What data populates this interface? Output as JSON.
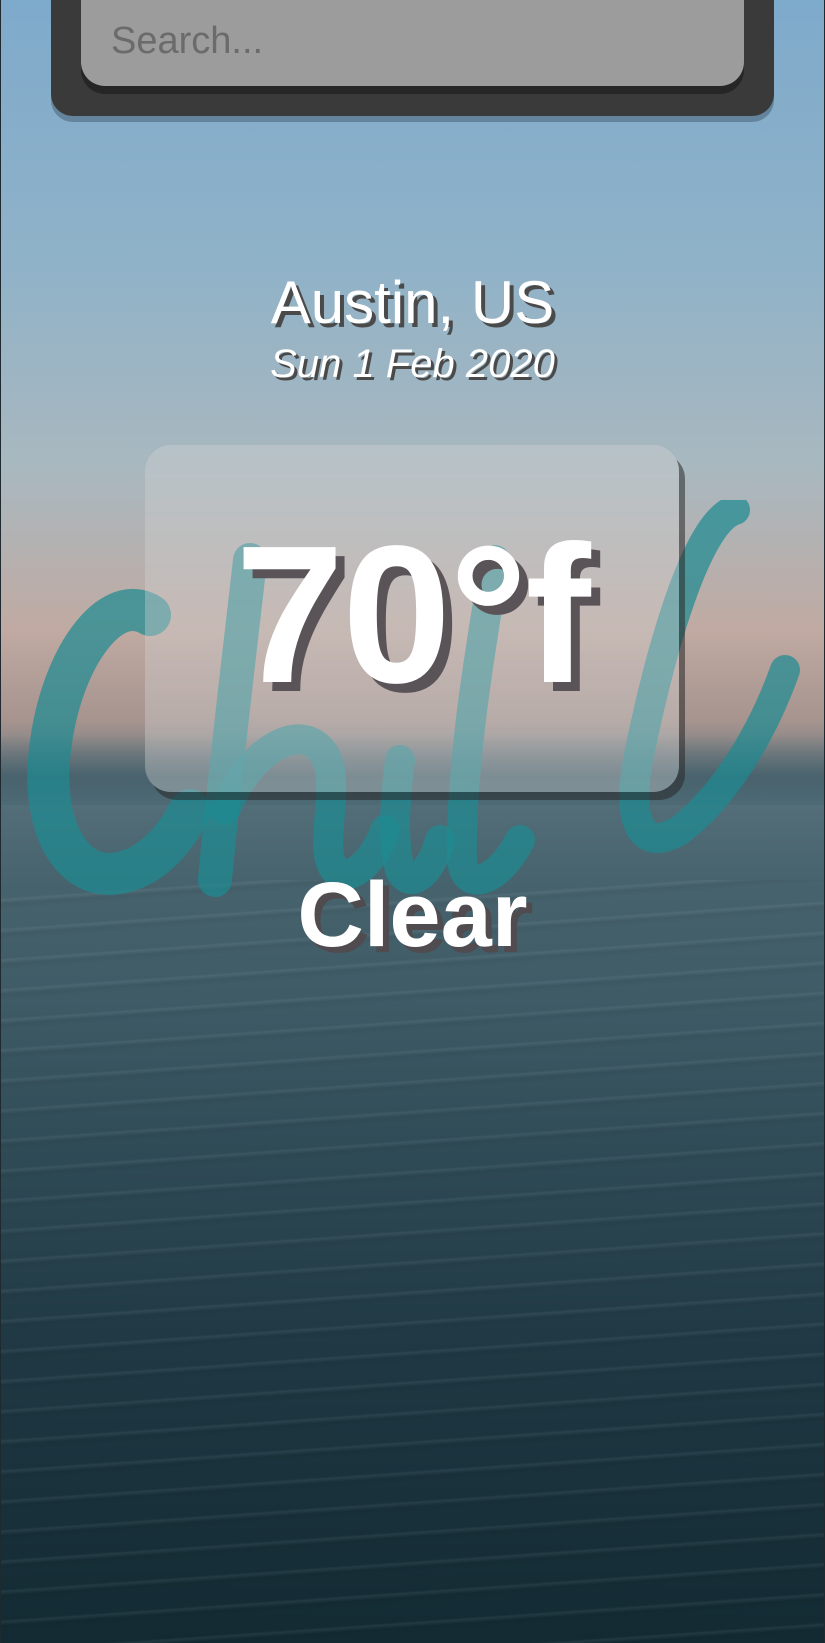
{
  "search": {
    "placeholder": "Search..."
  },
  "location": {
    "city": "Austin, US",
    "date": "Sun 1 Feb 2020"
  },
  "weather": {
    "temperature": "70°f",
    "condition": "Clear"
  },
  "watermark": {
    "text": "chill"
  },
  "colors": {
    "search_frame": "#3a3a3a",
    "search_input": "#9c9c9c",
    "text": "#ffffff",
    "watermark": "#1f8a92",
    "sky_top": "#7eaacb",
    "sea_bottom": "#132a33"
  },
  "icons": []
}
